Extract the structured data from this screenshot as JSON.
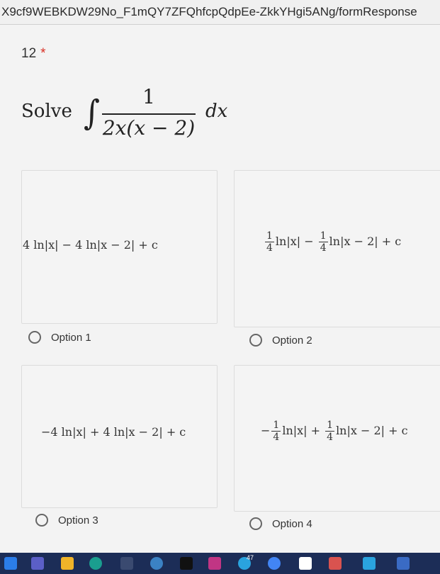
{
  "browser": {
    "url": "X9cf9WEBKDW29No_F1mQY7ZFQhfcpQdpEe-ZkkYHgi5ANg/formResponse"
  },
  "question": {
    "number": "12",
    "required_marker": "*",
    "prompt_word": "Solve",
    "integral_sign": "∫",
    "numerator": "1",
    "denominator": "2x(x − 2)",
    "differential": "dx"
  },
  "options": [
    {
      "expression": "4 ln|x| − 4 ln|x − 2| + c",
      "label": "Option 1"
    },
    {
      "expression_parts": [
        "1",
        "4",
        "ln|x| − ",
        "1",
        "4",
        "ln|x − 2| + c"
      ],
      "label": "Option 2"
    },
    {
      "expression": "−4 ln|x| + 4 ln|x − 2| + c",
      "label": "Option 3"
    },
    {
      "expression_parts": [
        "−",
        "1",
        "4",
        "ln|x| + ",
        "1",
        "4",
        "ln|x − 2| + c"
      ],
      "label": "Option 4"
    }
  ],
  "taskbar": {
    "badge_count": "47",
    "icons": [
      "start-icon",
      "teams-icon",
      "file-explorer-icon",
      "edge-icon",
      "grid-app-icon",
      "help-icon",
      "tiktok-icon",
      "instagram-icon",
      "telegram-icon",
      "chrome-icon",
      "notion-icon",
      "red-app-icon",
      "send-icon",
      "blue-app-icon"
    ]
  }
}
